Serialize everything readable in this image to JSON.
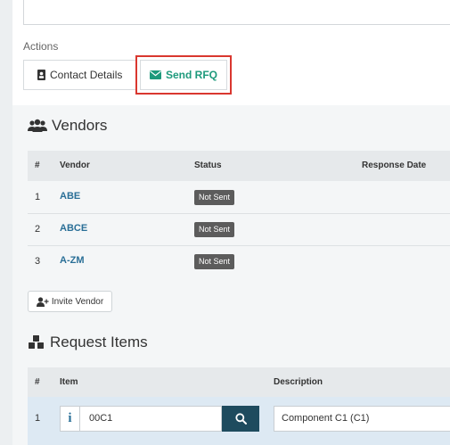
{
  "actions": {
    "label": "Actions",
    "contact_details": "Contact Details",
    "send_rfq": "Send RFQ"
  },
  "vendors": {
    "title": "Vendors",
    "columns": {
      "num": "#",
      "vendor": "Vendor",
      "status": "Status",
      "response_date": "Response Date"
    },
    "rows": [
      {
        "num": "1",
        "name": "ABE",
        "status": "Not Sent"
      },
      {
        "num": "2",
        "name": "ABCE",
        "status": "Not Sent"
      },
      {
        "num": "3",
        "name": "A-ZM",
        "status": "Not Sent"
      }
    ],
    "invite_label": "Invite Vendor"
  },
  "request_items": {
    "title": "Request Items",
    "columns": {
      "num": "#",
      "item": "Item",
      "description": "Description"
    },
    "rows": [
      {
        "num": "1",
        "item": "00C1",
        "description": "Component C1 (C1)"
      }
    ]
  },
  "colors": {
    "accent_green": "#1e9a7c",
    "link_blue": "#2a6f97",
    "highlight_red": "#d9372f",
    "search_btn": "#1e4b5e"
  }
}
